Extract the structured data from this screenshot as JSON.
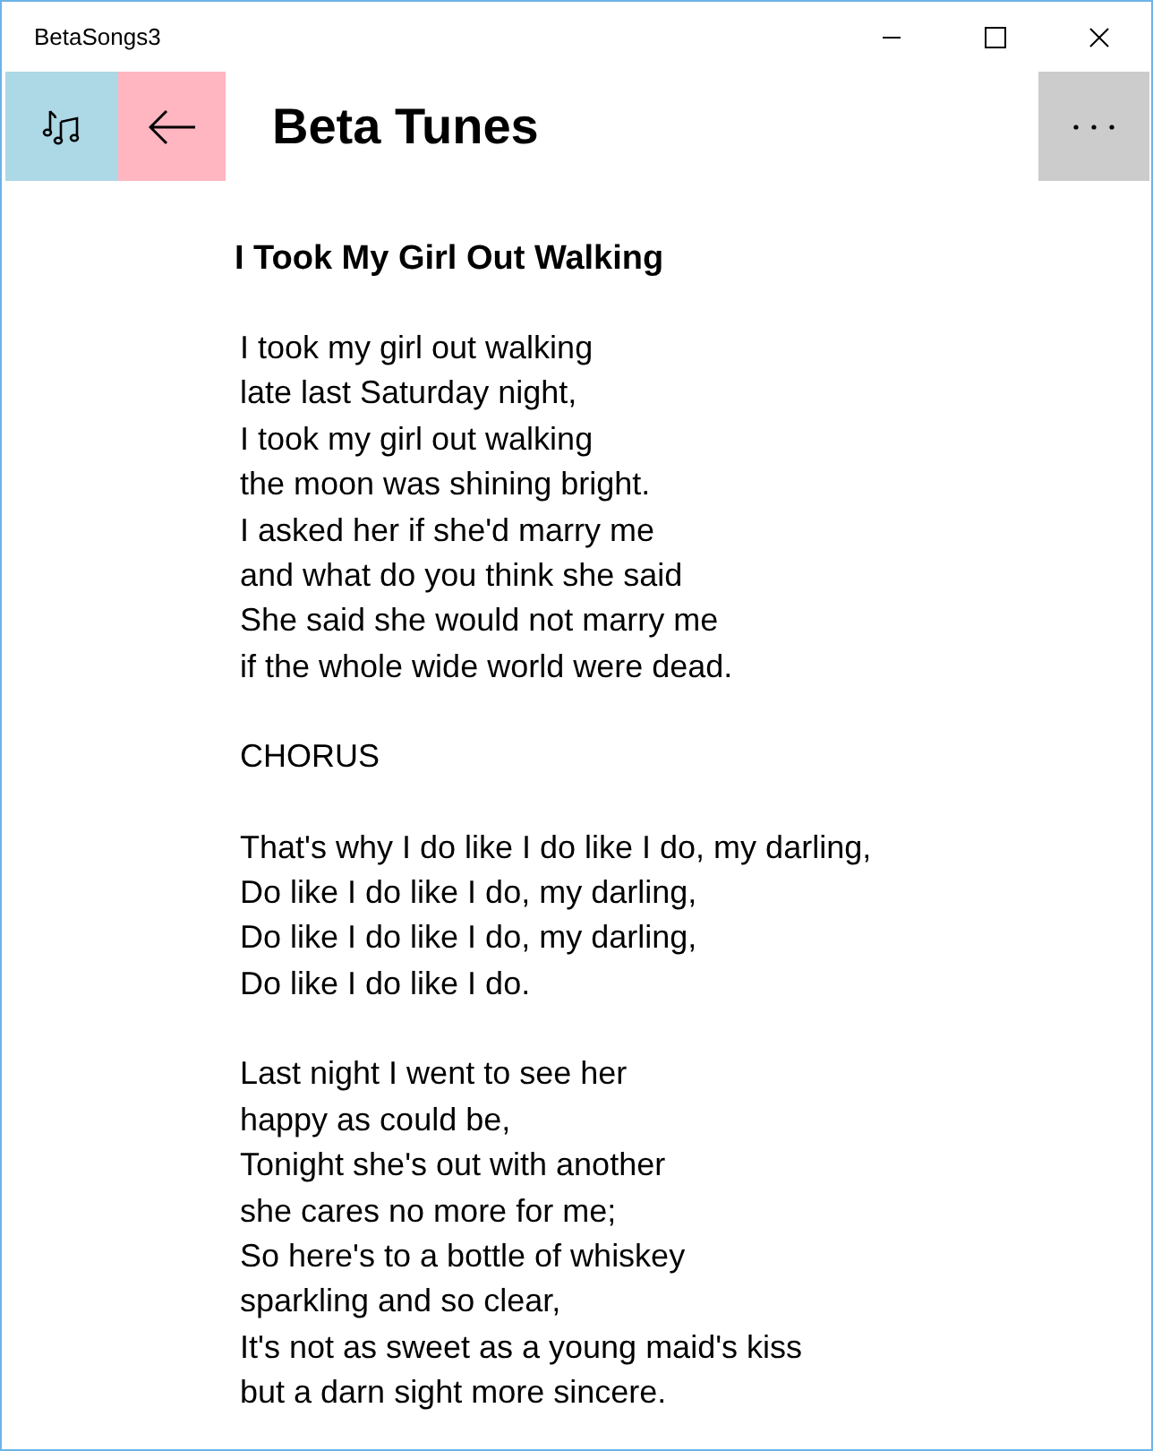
{
  "window": {
    "title": "BetaSongs3"
  },
  "header": {
    "title": "Beta Tunes"
  },
  "song": {
    "title": "I Took My Girl Out Walking",
    "stanzas": [
      {
        "lines": [
          "I took my girl out walking",
          "late last Saturday night,",
          "I took my girl out walking",
          "the moon was shining bright.",
          "I asked her if she'd marry me",
          "and what do you think she said",
          "She said she would not marry me",
          "if the whole wide world were dead."
        ]
      },
      {
        "lines": [
          "CHORUS"
        ]
      },
      {
        "lines": [
          "That's why I do like I do like I do, my darling,",
          "Do like I do like I do, my darling,",
          "Do like I do like I do, my darling,",
          "Do like I do like I do."
        ]
      },
      {
        "lines": [
          "Last night I went to see her",
          "happy as could be,",
          "Tonight she's out with another",
          "she cares no more for me;",
          "So here's to a bottle of whiskey",
          "sparkling and so clear,",
          "It's not as sweet as a young maid's kiss",
          "but a darn sight more sincere."
        ]
      }
    ]
  }
}
